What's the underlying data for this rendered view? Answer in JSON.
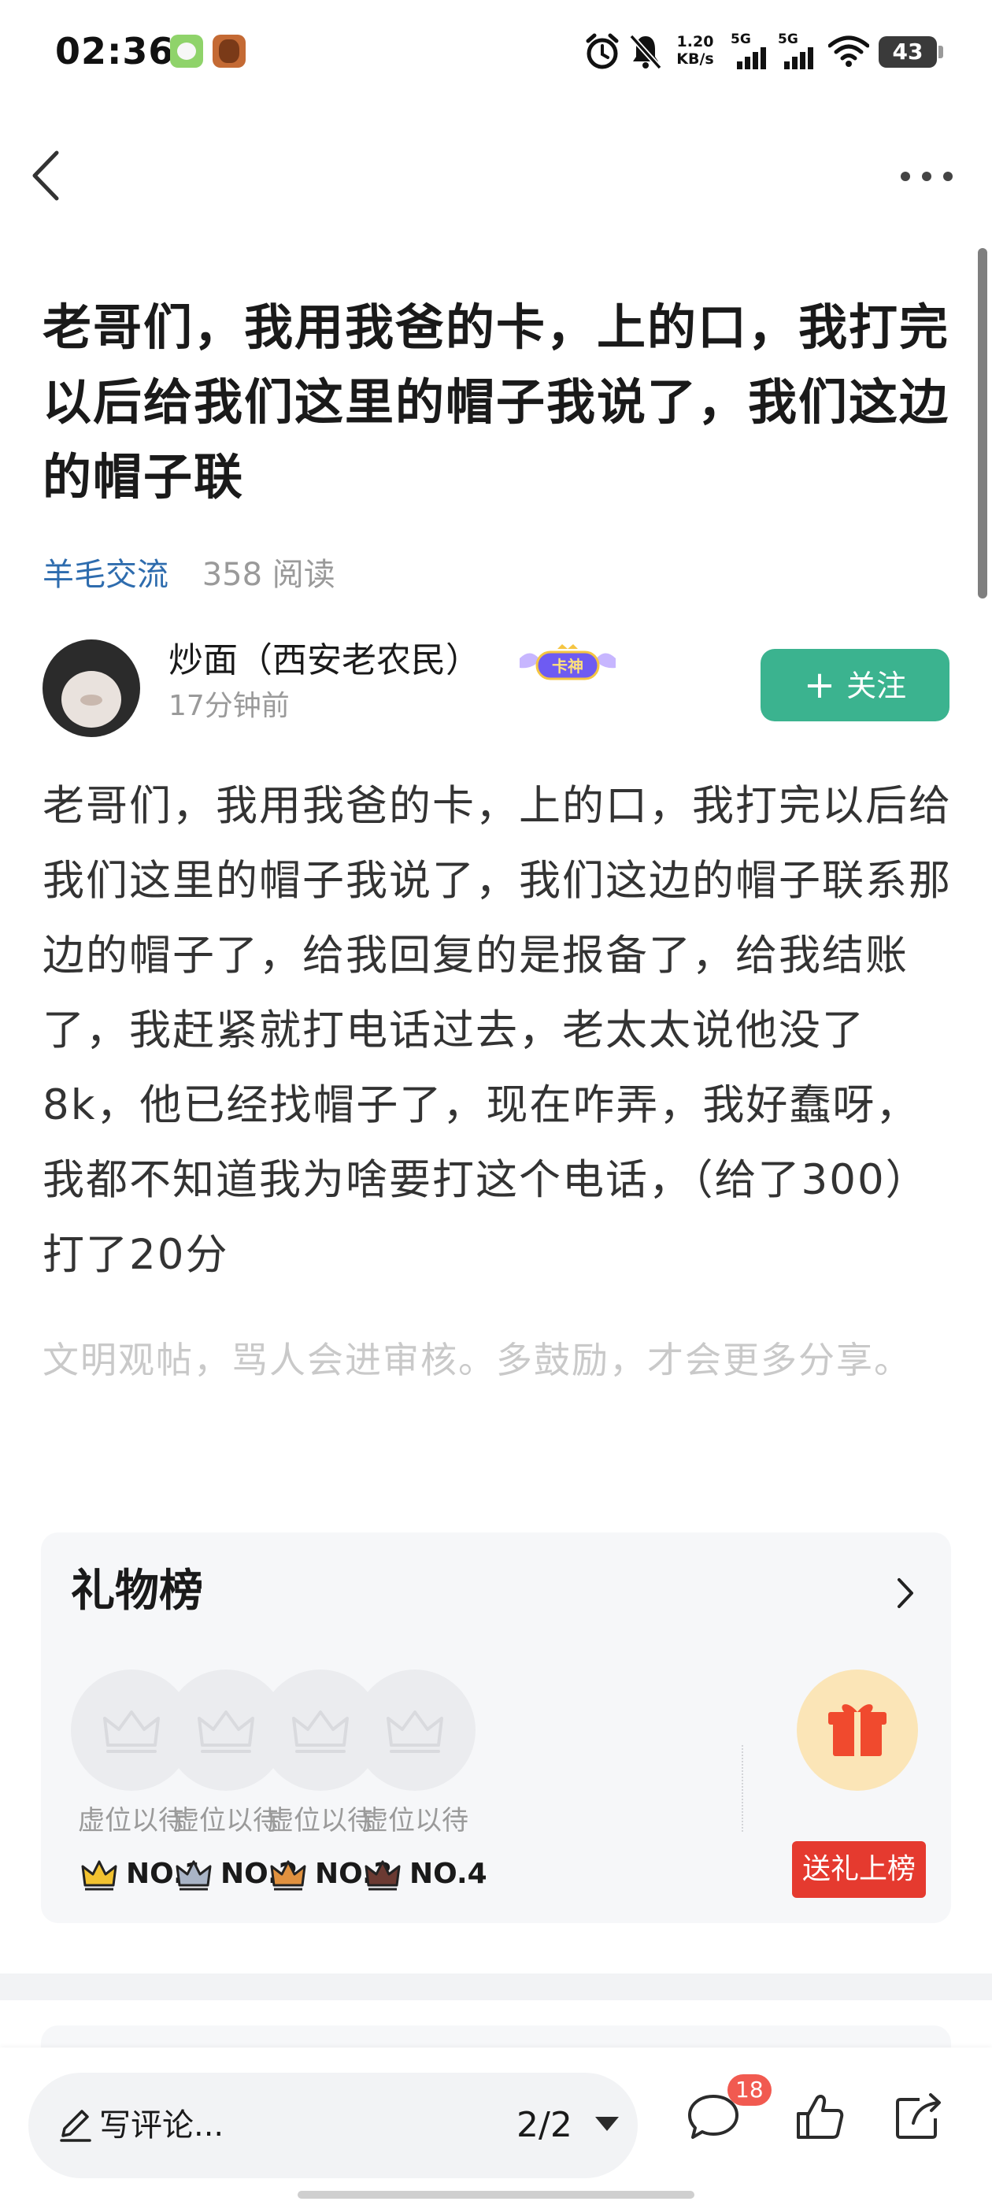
{
  "status_bar": {
    "time": "02:36",
    "net_speed_value": "1.20",
    "net_speed_unit": "KB/s",
    "signal1_label": "5G",
    "signal2_label": "5G",
    "battery": "43",
    "icons": [
      "app-icon-green",
      "app-icon-game",
      "alarm-icon",
      "mute-bell-icon",
      "signal-icon",
      "signal-icon",
      "wifi-icon",
      "battery-icon"
    ]
  },
  "header": {
    "back_icon": "chevron-left-icon",
    "more_icon": "more-dots-icon"
  },
  "post": {
    "title": "老哥们，我用我爸的卡，上的口，我打完以后给我们这里的帽子我说了，我们这边的帽子联",
    "category": "羊毛交流",
    "reads": "358 阅读",
    "author": {
      "name": "炒面（西安老农民）",
      "badge": "卡神",
      "time": "17分钟前"
    },
    "follow_label": "关注",
    "body": "老哥们，我用我爸的卡，上的口，我打完以后给我们这里的帽子我说了，我们这边的帽子联系那边的帽子了，给我回复的是报备了，给我结账了，我赶紧就打电话过去，老太太说他没了8k，他已经找帽子了，现在咋弄，我好蠢呀，我都不知道我为啥要打这个电话，（给了300）打了20分",
    "civility_note": "文明观帖，骂人会进审核。多鼓励，才会更多分享。"
  },
  "gift_board": {
    "title": "礼物榜",
    "slots": [
      {
        "label": "虚位以待",
        "rank": "NO.1",
        "crown_color": "#f2c230"
      },
      {
        "label": "虚位以待",
        "rank": "NO.2",
        "crown_color": "#a9b4c6"
      },
      {
        "label": "虚位以待",
        "rank": "NO.3",
        "crown_color": "#e0913f"
      },
      {
        "label": "虚位以待",
        "rank": "NO.4",
        "crown_color": "#6b3a32"
      }
    ],
    "send_gift_label": "送礼上榜"
  },
  "bottom_bar": {
    "comment_placeholder": "写评论...",
    "page_indicator": "2/2",
    "comment_count": "18"
  },
  "colors": {
    "accent_green": "#3bb38f",
    "category_blue": "#2e6cae",
    "gift_red": "#e53a2f",
    "badge_red": "#f15a50"
  }
}
